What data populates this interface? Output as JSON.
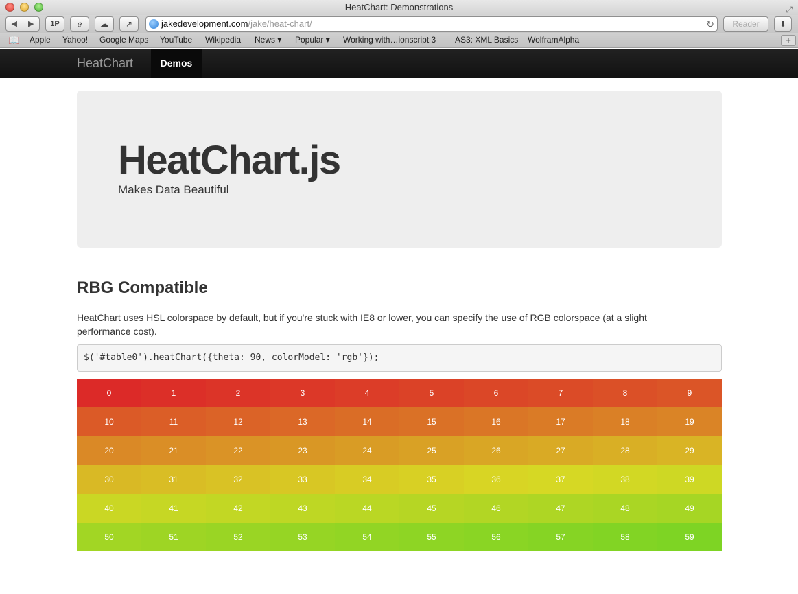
{
  "window": {
    "title": "HeatChart: Demonstrations"
  },
  "toolbar": {
    "back_icon": "back-arrow-icon",
    "forward_icon": "forward-arrow-icon",
    "onepassword_label": "1P",
    "url_host": "jakedevelopment.com",
    "url_path": "/jake/heat-chart/",
    "reader_label": "Reader"
  },
  "bookmarks": [
    "Apple",
    "Yahoo!",
    "Google Maps",
    "YouTube",
    "Wikipedia",
    "News ▾",
    "Popular ▾",
    "Working with…ionscript 3",
    "AS3: XML Basics",
    "WolframAlpha"
  ],
  "navbar": {
    "brand": "HeatChart",
    "active_item": "Demos"
  },
  "hero": {
    "title": "HeatChart.js",
    "subtitle": "Makes Data Beautiful"
  },
  "section": {
    "title": "RBG Compatible",
    "description": "HeatChart uses HSL colorspace by default, but if you're stuck with IE8 or lower, you can specify the use of RGB colorspace (at a slight performance cost).",
    "code": "$('#table0').heatChart({theta: 90, colorModel: 'rgb'});"
  },
  "heat_table": {
    "rows": [
      [
        "0",
        "1",
        "2",
        "3",
        "4",
        "5",
        "6",
        "7",
        "8",
        "9"
      ],
      [
        "10",
        "11",
        "12",
        "13",
        "14",
        "15",
        "16",
        "17",
        "18",
        "19"
      ],
      [
        "20",
        "21",
        "22",
        "23",
        "24",
        "25",
        "26",
        "27",
        "28",
        "29"
      ],
      [
        "30",
        "31",
        "32",
        "33",
        "34",
        "35",
        "36",
        "37",
        "38",
        "39"
      ],
      [
        "40",
        "41",
        "42",
        "43",
        "44",
        "45",
        "46",
        "47",
        "48",
        "49"
      ],
      [
        "50",
        "51",
        "52",
        "53",
        "54",
        "55",
        "56",
        "57",
        "58",
        "59"
      ]
    ],
    "color_low": "#dc2a28",
    "color_high": "#7ed424"
  }
}
